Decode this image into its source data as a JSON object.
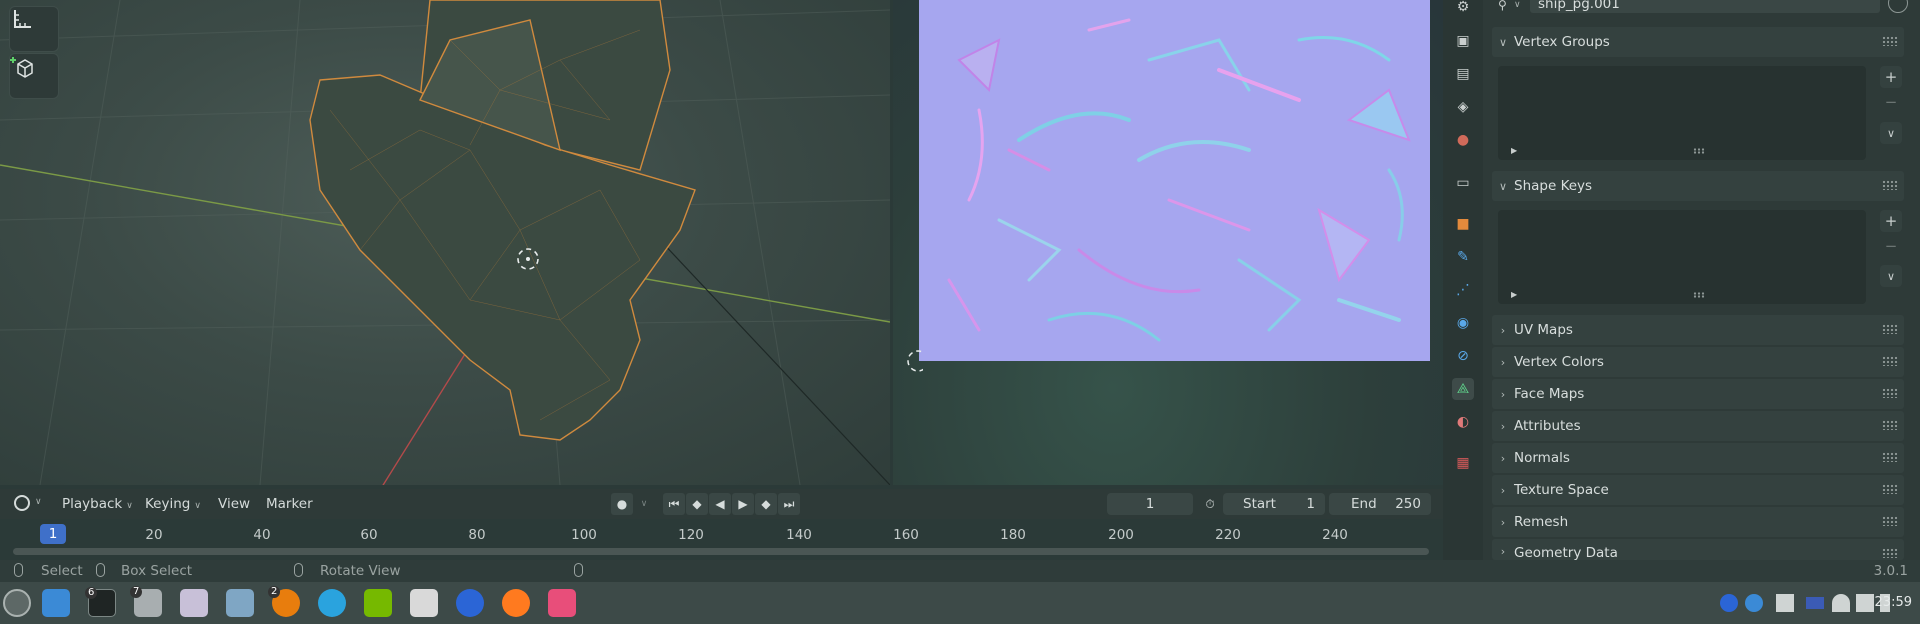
{
  "viewport": {
    "tools": [
      {
        "name": "measure-tool",
        "icon": "ruler-icon"
      },
      {
        "name": "add-cube-tool",
        "icon": "add-cube-icon"
      }
    ]
  },
  "properties": {
    "object_data_name": "ship_pg.001",
    "panels": [
      {
        "label": "Vertex Groups",
        "expanded": true
      },
      {
        "label": "Shape Keys",
        "expanded": true
      },
      {
        "label": "UV Maps",
        "expanded": false
      },
      {
        "label": "Vertex Colors",
        "expanded": false
      },
      {
        "label": "Face Maps",
        "expanded": false
      },
      {
        "label": "Attributes",
        "expanded": false
      },
      {
        "label": "Normals",
        "expanded": false
      },
      {
        "label": "Texture Space",
        "expanded": false
      },
      {
        "label": "Remesh",
        "expanded": false
      },
      {
        "label": "Geometry Data",
        "expanded": false
      }
    ],
    "add_symbol": "+",
    "remove_symbol": "−"
  },
  "timeline": {
    "menus": {
      "playback": "Playback",
      "keying": "Keying",
      "view": "View",
      "marker": "Marker"
    },
    "current_frame": "1",
    "start_label": "Start",
    "start_value": "1",
    "end_label": "End",
    "end_value": "250",
    "ruler_ticks": [
      "1",
      "20",
      "40",
      "60",
      "80",
      "100",
      "120",
      "140",
      "160",
      "180",
      "200",
      "220",
      "240"
    ]
  },
  "statusbar": {
    "select": "Select",
    "box_select": "Box Select",
    "rotate_view": "Rotate View",
    "version": "3.0.1"
  },
  "taskbar": {
    "terminal_badge": "6",
    "files_badge": "7",
    "blender_badge": "2",
    "clock": "23:59"
  },
  "colors": {
    "accent": "#3f70c9",
    "mesh_wire": "#d08a3e",
    "texture_base": "#a6a6ef"
  }
}
